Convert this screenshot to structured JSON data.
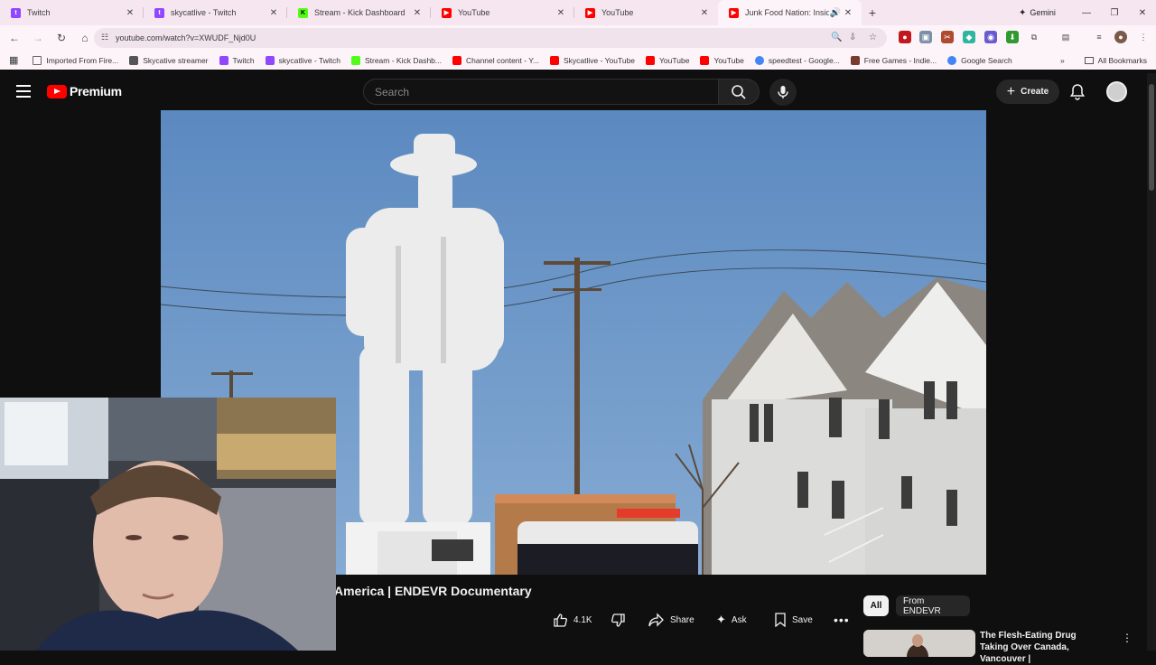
{
  "browser": {
    "tabs": [
      {
        "title": "Twitch",
        "icon": "twitch-icon",
        "color": "#9146ff"
      },
      {
        "title": "skycatlive - Twitch",
        "icon": "twitch-icon",
        "color": "#9146ff"
      },
      {
        "title": "Stream - Kick Dashboard",
        "icon": "kick-icon",
        "color": "#53fc18"
      },
      {
        "title": "YouTube",
        "icon": "youtube-icon",
        "color": "#ff0000"
      },
      {
        "title": "YouTube",
        "icon": "youtube-icon",
        "color": "#ff0000"
      },
      {
        "title": "Junk Food Nation: Inside Th",
        "icon": "youtube-icon",
        "color": "#ff0000",
        "active": true
      }
    ],
    "gemini_label": "Gemini",
    "url": "youtube.com/watch?v=XWUDF_Njd0U",
    "bookmarks": [
      {
        "label": "Imported From Fire...",
        "icon": "folder-icon",
        "color": "#666666"
      },
      {
        "label": "Skycative streamer",
        "icon": "skycat-icon",
        "color": "#555555"
      },
      {
        "label": "Twitch",
        "icon": "twitch-icon",
        "color": "#9146ff"
      },
      {
        "label": "skycatlive - Twitch",
        "icon": "twitch-icon",
        "color": "#9146ff"
      },
      {
        "label": "Stream - Kick Dashb...",
        "icon": "kick-icon",
        "color": "#53fc18"
      },
      {
        "label": "Channel content - Y...",
        "icon": "youtube-icon",
        "color": "#ff0000"
      },
      {
        "label": "Skycatlive - YouTube",
        "icon": "youtube-icon",
        "color": "#ff0000"
      },
      {
        "label": "YouTube",
        "icon": "youtube-icon",
        "color": "#ff0000"
      },
      {
        "label": "YouTube",
        "icon": "youtube-icon",
        "color": "#ff0000"
      },
      {
        "label": "speedtest - Google...",
        "icon": "google-icon",
        "color": "#4285f4"
      },
      {
        "label": "Free Games - Indie...",
        "icon": "game-icon",
        "color": "#7a3b2e"
      },
      {
        "label": "Google Search",
        "icon": "google-icon",
        "color": "#4285f4"
      }
    ],
    "all_bookmarks_label": "All Bookmarks"
  },
  "youtube": {
    "logo_text": "Premium",
    "search_placeholder": "Search",
    "create_label": "Create",
    "video_title": "America | ENDEVR Documentary",
    "actions": {
      "like_count": "4.1K",
      "share_label": "Share",
      "ask_label": "Ask",
      "save_label": "Save"
    },
    "chips": [
      "All",
      "From ENDEVR"
    ],
    "recommendation": {
      "title": "The Flesh-Eating Drug Taking Over Canada, Vancouver |"
    }
  },
  "colors": {
    "brand_red": "#ff0000",
    "yt_bg": "#0f0f0f",
    "chrome_tab_bg": "#f6e6f0"
  }
}
